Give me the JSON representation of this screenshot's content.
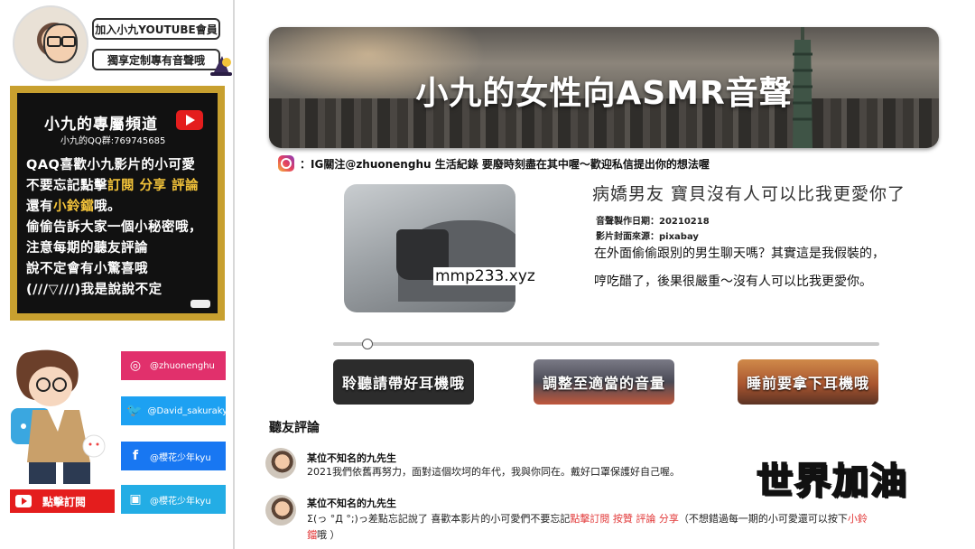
{
  "sidebar": {
    "join_button": "加入小九YOUTUBE會員",
    "custom_button": "獨享定制專有音聲哦",
    "channel": {
      "title": "小九的專屬頻道",
      "qq": "小九的QQ群:769745685",
      "lines": [
        [
          "QAQ喜歡小九影片的小可愛",
          ""
        ],
        [
          "不要忘記點擊",
          "訂閱 分享 評論"
        ],
        [
          "還有",
          "小鈴鐺",
          "哦。"
        ],
        [
          "偷偷告訴大家一個小秘密哦，",
          ""
        ],
        [
          "注意每期的聽友評論",
          ""
        ],
        [
          "說不定會有小驚喜哦",
          ""
        ],
        [
          "(///▽///)我是說說不定",
          ""
        ]
      ]
    },
    "socials": [
      {
        "label": "@zhuonenghu",
        "icon": "instagram-icon",
        "color": "#e1306c"
      },
      {
        "label": "@David_sakurakyu",
        "icon": "twitter-icon",
        "color": "#1da1f2"
      },
      {
        "label": "@櫻花少年kyu",
        "icon": "facebook-icon",
        "color": "#1877f2"
      },
      {
        "label": "@櫻花少年kyu",
        "icon": "bilibili-icon",
        "color": "#23ade5"
      }
    ],
    "subscribe": "點擊訂閱"
  },
  "banner": {
    "title": "小九的女性向ASMR音聲"
  },
  "ig_note": "：IG關注@zhuonenghu 生活紀錄 要廢時刻盡在其中喔～歡迎私信提出你的想法喔",
  "video": {
    "title": "病嬌男友  寶貝沒有人可以比我更愛你了",
    "date": "音聲製作日期：20210218",
    "cover_source": "影片封面來源：pixabay",
    "description": "在外面偷偷跟別的男生聊天嗎？其實這是我假裝的，哼吃醋了，後果很嚴重～沒有人可以比我更愛你。",
    "watermark": "mmp233.xyz",
    "progress": 0.06
  },
  "buttons": [
    "聆聽請帶好耳機哦",
    "調整至適當的音量",
    "睡前要拿下耳機哦"
  ],
  "comments": {
    "title": "聽友評論",
    "items": [
      {
        "name": "某位不知名的九先生",
        "text": "2021我們依舊再努力，面對這個坎坷的年代，我與你同在。戴好口罩保護好自己喔。"
      },
      {
        "name": "某位不知名的九先生",
        "text_parts": [
          "Σ(っ °Д °;)っ差點忘記說了 喜歡本影片的小可愛們不要忘記",
          "點擊訂閱 按贊 評論 分享",
          "（不想錯過每一期的小可愛還可以按下",
          "小鈴鐺",
          "哦 ）"
        ]
      }
    ]
  },
  "cheer": "世界加油"
}
